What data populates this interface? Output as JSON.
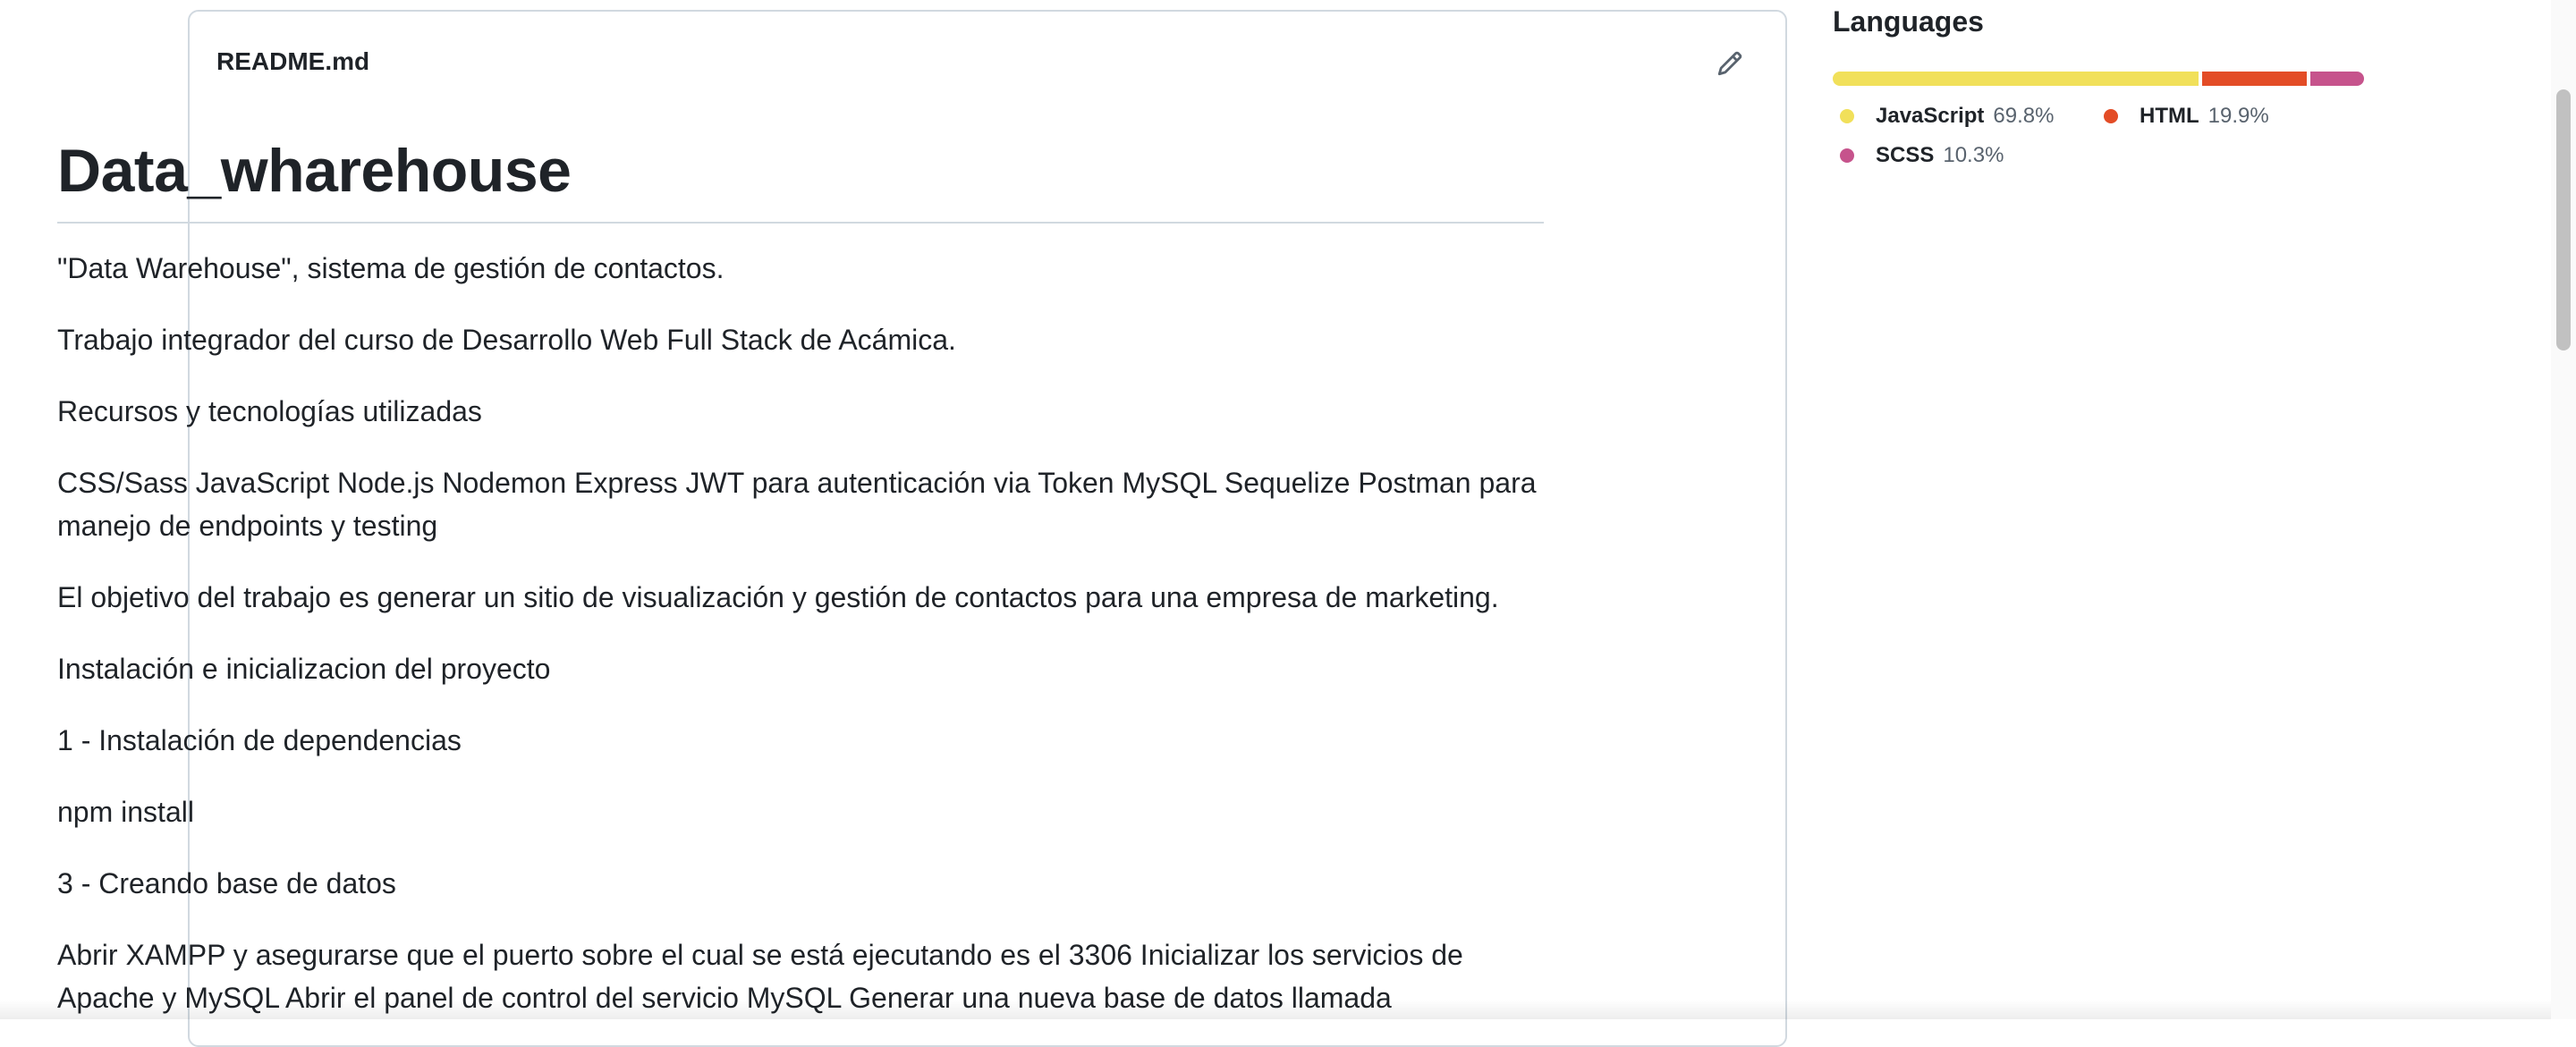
{
  "readme": {
    "filename": "README.md",
    "title": "Data_wharehouse",
    "paragraphs": [
      "\"Data Warehouse\", sistema de gestión de contactos.",
      "Trabajo integrador del curso de Desarrollo Web Full Stack de Acámica.",
      "Recursos y tecnologías utilizadas",
      "CSS/Sass JavaScript Node.js Nodemon Express JWT para autenticación via Token MySQL Sequelize Postman para manejo de endpoints y testing",
      "El objetivo del trabajo es generar un sitio de visualización y gestión de contactos para una empresa de marketing.",
      "Instalación e inicializacion del proyecto",
      "1 - Instalación de dependencias",
      "npm install",
      "3 - Creando base de datos",
      "Abrir XAMPP y asegurarse que el puerto sobre el cual se está ejecutando es el 3306 Inicializar los servicios de Apache y MySQL Abrir el panel de control del servicio MySQL Generar una nueva base de datos llamada"
    ]
  },
  "sidebar": {
    "languages_title": "Languages",
    "languages": [
      {
        "name": "JavaScript",
        "percent": "69.8%",
        "value": 69.8,
        "color": "#f1e05a"
      },
      {
        "name": "HTML",
        "percent": "19.9%",
        "value": 19.9,
        "color": "#e34c26"
      },
      {
        "name": "SCSS",
        "percent": "10.3%",
        "value": 10.3,
        "color": "#c6538c"
      }
    ]
  },
  "icons": {
    "edit": "pencil-icon"
  }
}
